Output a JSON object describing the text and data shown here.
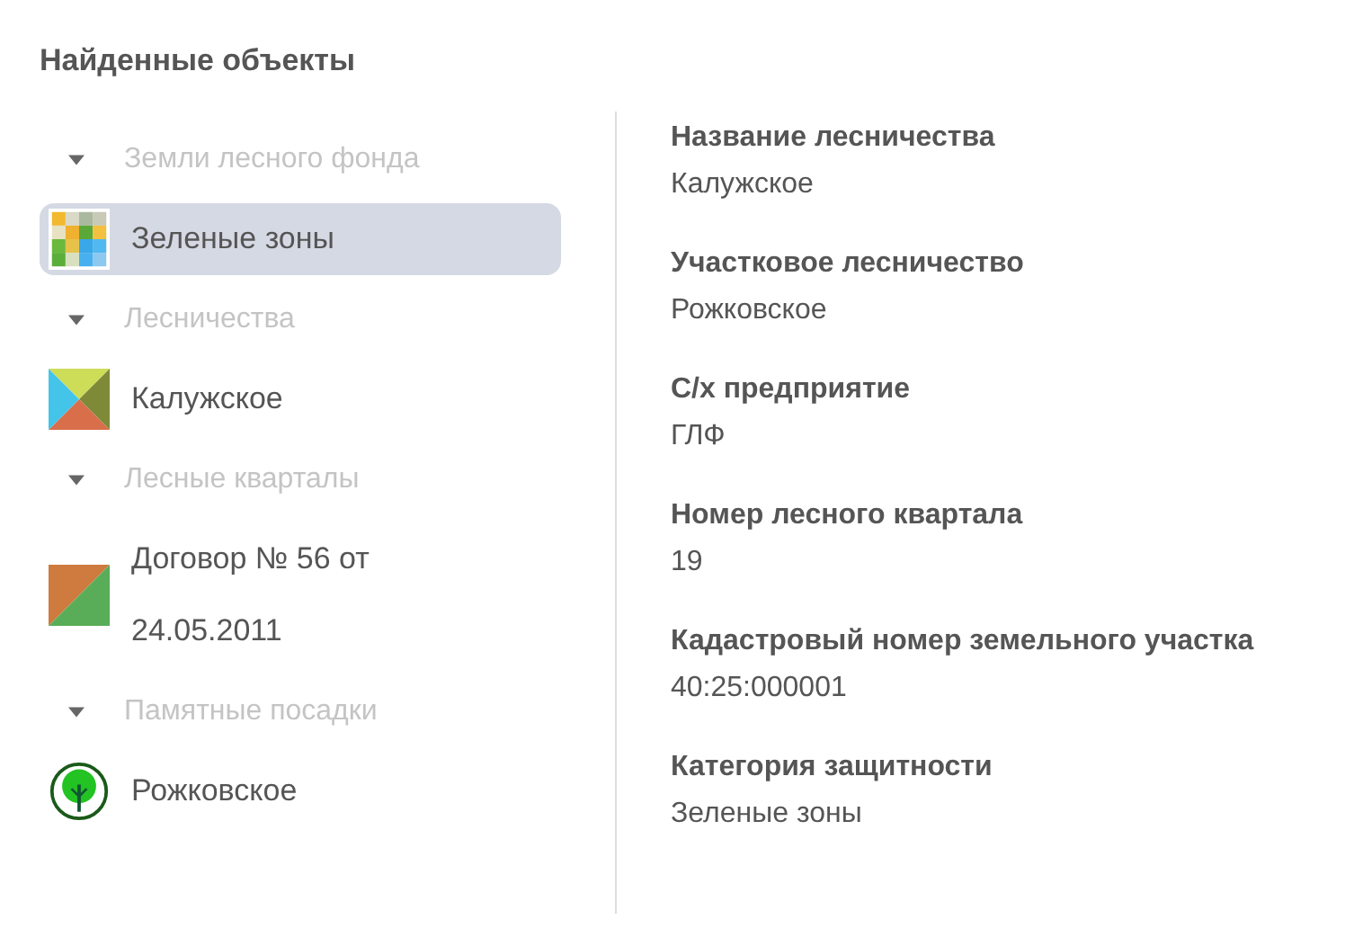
{
  "title": "Найденные объекты",
  "groups": [
    {
      "label": "Земли лесного фонда",
      "expanded": true,
      "children": [
        {
          "label": "Зеленые зоны",
          "kind": "mosaic",
          "selected": true
        }
      ]
    },
    {
      "label": "Лесничества",
      "expanded": true,
      "children": [
        {
          "label": "Калужское",
          "kind": "quad",
          "selected": false
        }
      ]
    },
    {
      "label": "Лесные кварталы",
      "expanded": true,
      "children": [
        {
          "label": "Договор № 56 от 24.05.2011",
          "kind": "split",
          "selected": false
        }
      ]
    },
    {
      "label": "Памятные посадки",
      "expanded": true,
      "children": [
        {
          "label": "Рожковское",
          "kind": "tree",
          "selected": false
        }
      ]
    }
  ],
  "properties": [
    {
      "label": "Название лесничества",
      "value": "Калужское"
    },
    {
      "label": "Участковое лесничество",
      "value": "Рожковское"
    },
    {
      "label": "С/х предприятие",
      "value": "ГЛФ"
    },
    {
      "label": "Номер лесного квартала",
      "value": "19"
    },
    {
      "label": "Кадастровый номер земельного участка",
      "value": "40:25:000001"
    },
    {
      "label": "Категория защитности",
      "value": "Зеленые зоны"
    }
  ]
}
